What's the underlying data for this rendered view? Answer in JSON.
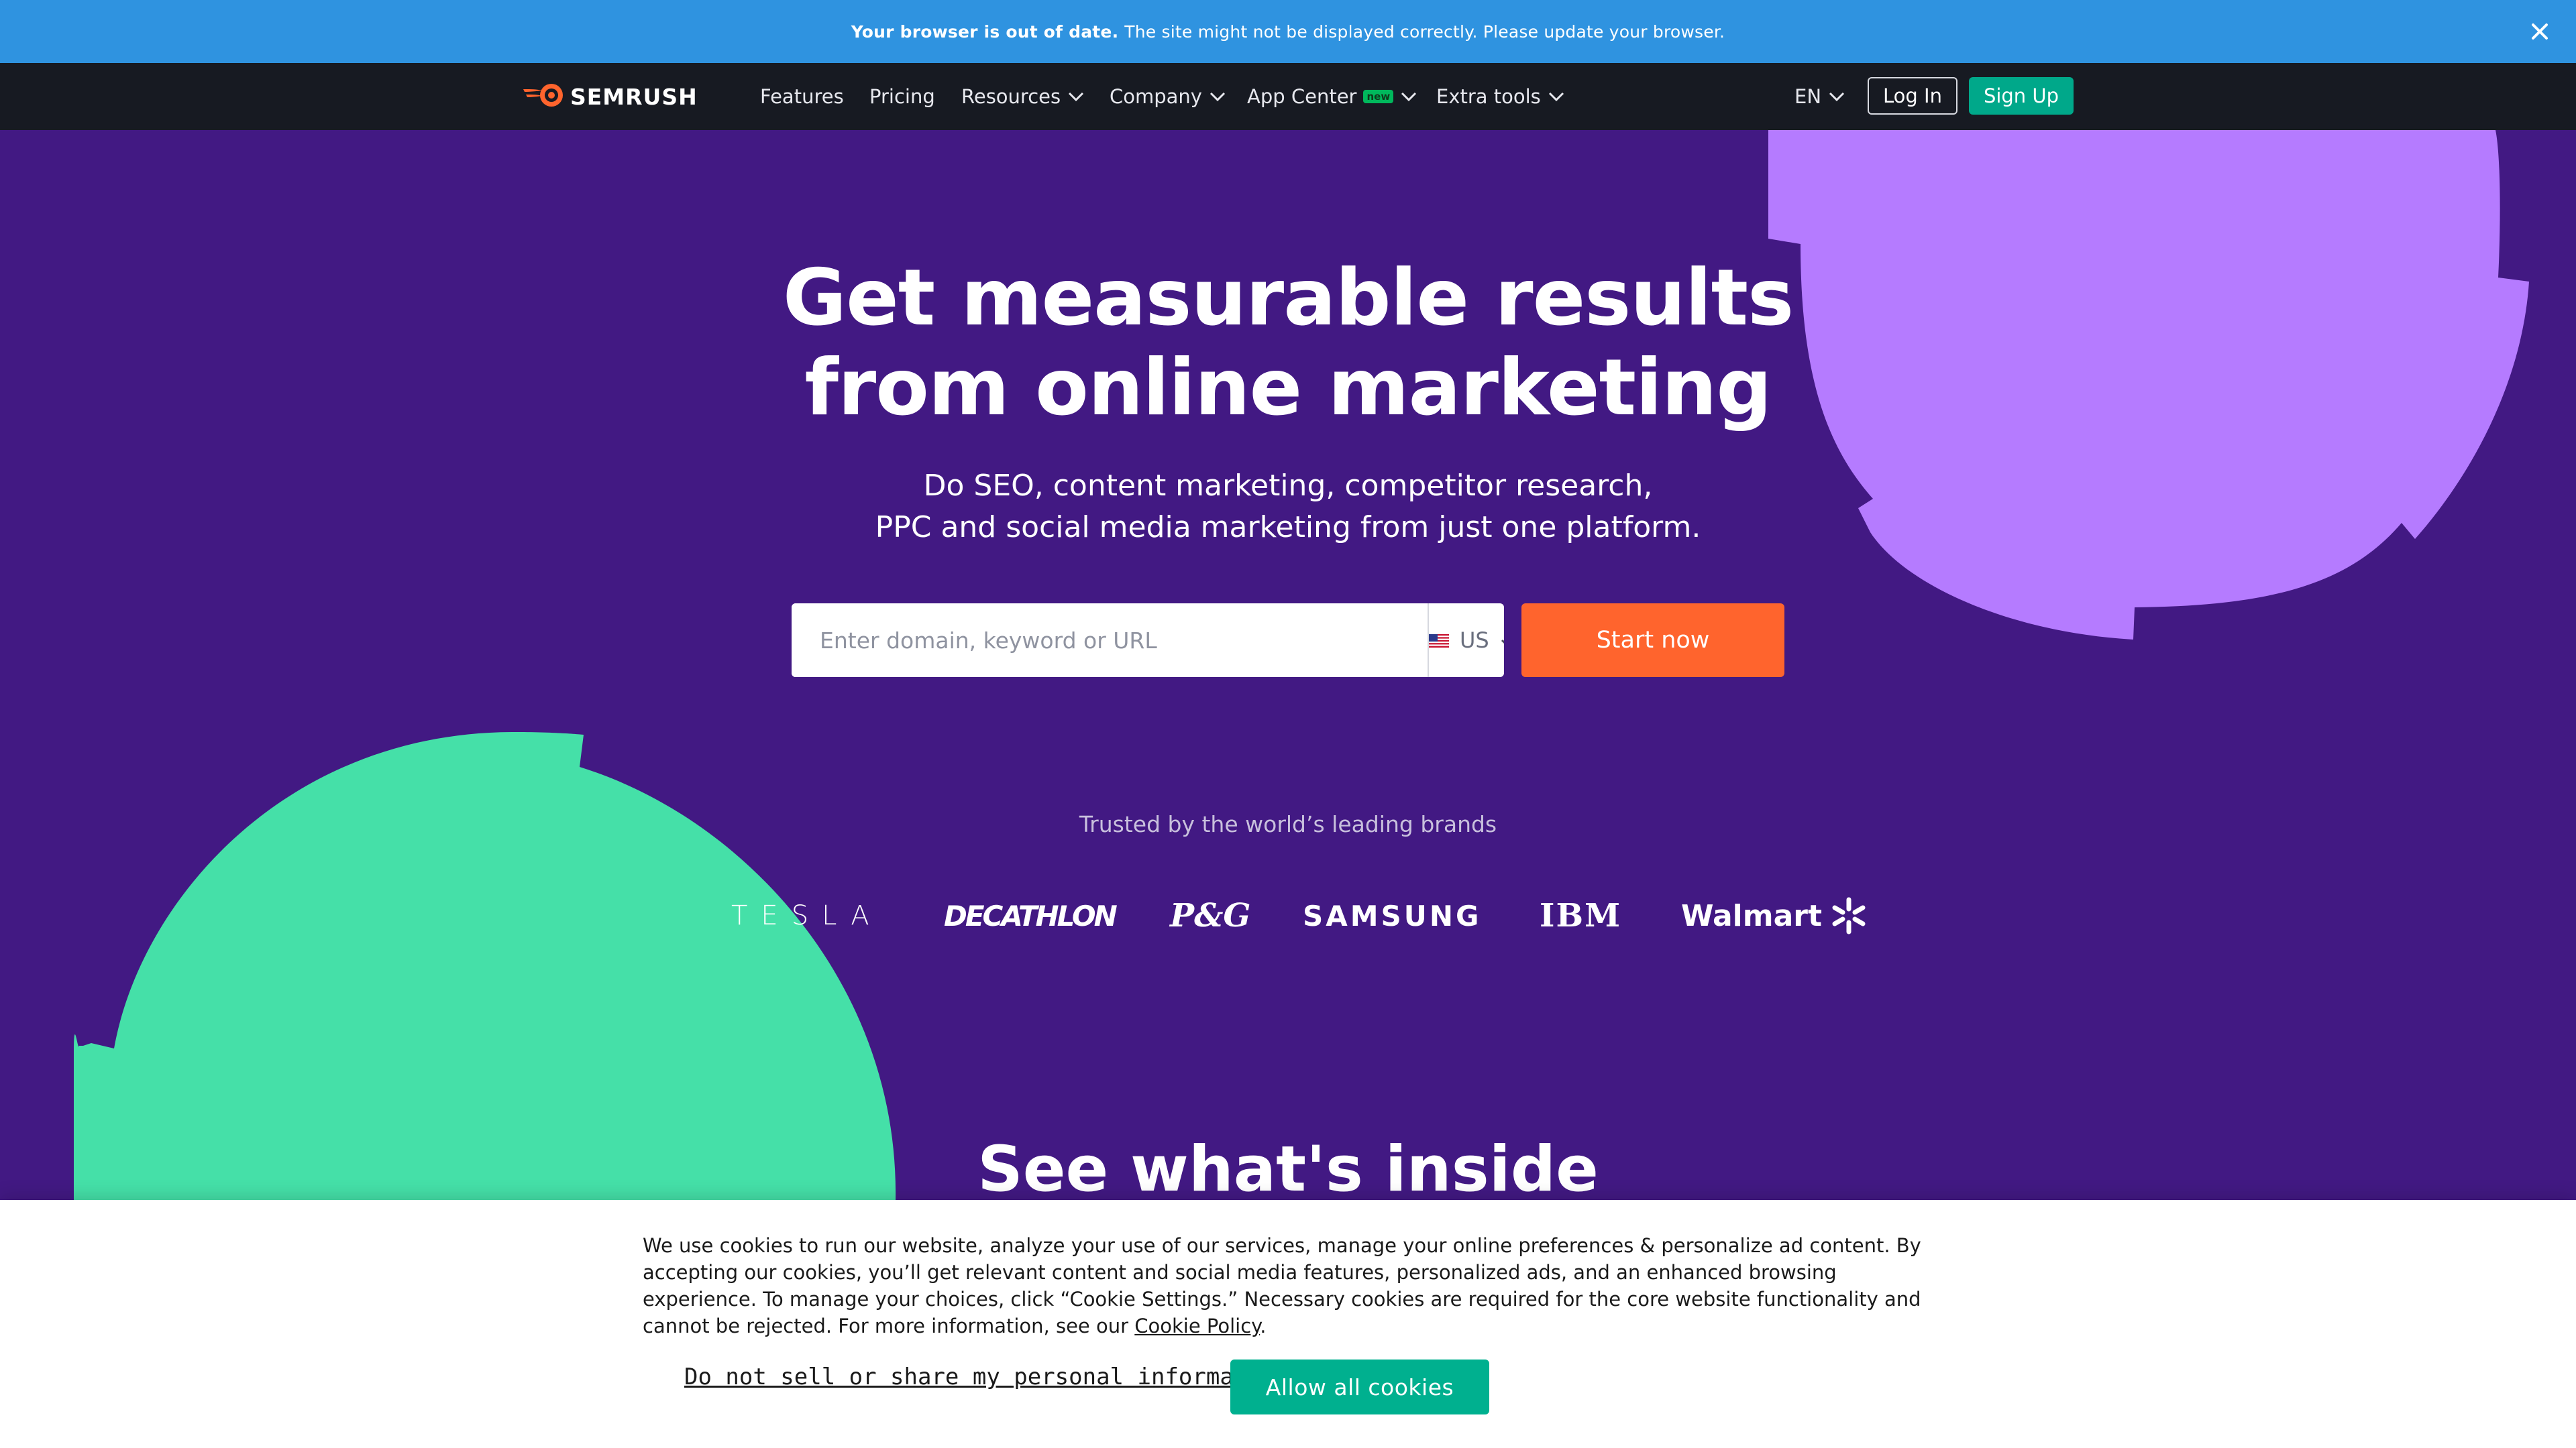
{
  "banner": {
    "bold_text": "Your browser is out of date.",
    "text": "The site might not be displayed correctly. Please update your browser.",
    "close_icon": "close-icon",
    "background": "#2f93e0"
  },
  "nav": {
    "logo_text": "SEMRUSH",
    "logo_icon": "semrush-fire-icon",
    "items": [
      {
        "label": "Features",
        "has_dropdown": false
      },
      {
        "label": "Pricing",
        "has_dropdown": false
      },
      {
        "label": "Resources",
        "has_dropdown": true
      },
      {
        "label": "Company",
        "has_dropdown": true
      },
      {
        "label": "App Center",
        "has_dropdown": true,
        "badge": "new"
      },
      {
        "label": "Extra tools",
        "has_dropdown": true
      }
    ],
    "language": "EN",
    "login_label": "Log In",
    "signup_label": "Sign Up",
    "background": "#171a22"
  },
  "hero": {
    "title_line1": "Get measurable results",
    "title_line2": "from online marketing",
    "subtitle_line1": "Do SEO, content marketing, competitor research,",
    "subtitle_line2": "PPC and social media marketing from just one platform.",
    "search_placeholder": "Enter domain, keyword or URL",
    "search_value": "",
    "country": "US",
    "country_flag_icon": "us-flag-icon",
    "start_label": "Start now",
    "background": "#421983",
    "accent": "#ff642d"
  },
  "trusted": {
    "label": "Trusted by the world’s leading brands",
    "brands": [
      "TESLA",
      "DECATHLON",
      "P&G",
      "SAMSUNG",
      "IBM",
      "Walmart"
    ]
  },
  "inside": {
    "title": "See what's inside"
  },
  "cookie": {
    "text": "We use cookies to run our website, analyze your use of our services, manage your online preferences & personalize ad content. By accepting our cookies, you’ll get relevant content and social media features, personalized ads, and an enhanced browsing experience. To manage your choices, click “Cookie Settings.” Necessary cookies are required for the core website functionality and cannot be rejected. For more information, see our",
    "policy_link": "Cookie Policy",
    "policy_suffix": ".",
    "do_not_sell_label": "Do not sell or share my personal information",
    "allow_label": "Allow all cookies",
    "allow_color": "#00b08f"
  }
}
